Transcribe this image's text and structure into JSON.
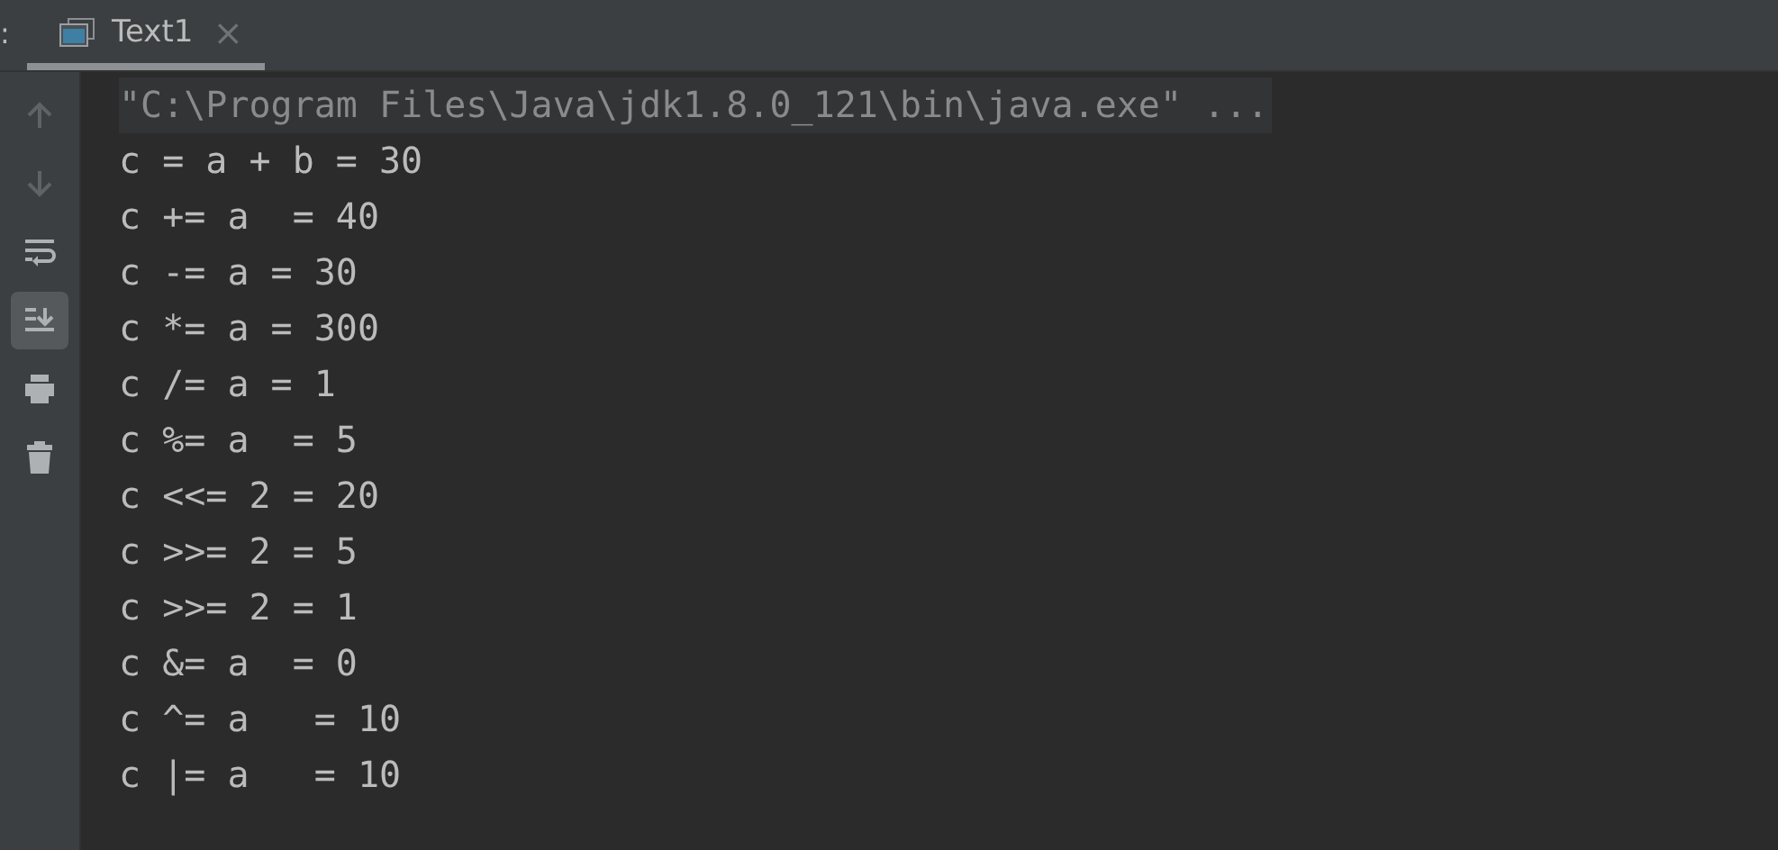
{
  "header": {
    "marker": ":"
  },
  "tabs": [
    {
      "label": "Text1",
      "close": "×",
      "selected": true
    }
  ],
  "toolbar": [
    {
      "kind": "up",
      "disabled": true,
      "selected": false
    },
    {
      "kind": "down",
      "disabled": true,
      "selected": false
    },
    {
      "kind": "wrap",
      "disabled": false,
      "selected": false
    },
    {
      "kind": "scroll-end",
      "disabled": false,
      "selected": true
    },
    {
      "kind": "print",
      "disabled": false,
      "selected": false
    },
    {
      "kind": "trash",
      "disabled": false,
      "selected": false
    }
  ],
  "console": {
    "command": "\"C:\\Program Files\\Java\\jdk1.8.0_121\\bin\\java.exe\" ...",
    "lines": [
      "c = a + b = 30",
      "c += a  = 40",
      "c -= a = 30",
      "c *= a = 300",
      "c /= a = 1",
      "c %= a  = 5",
      "c <<= 2 = 20",
      "c >>= 2 = 5",
      "c >>= 2 = 1",
      "c &= a  = 0",
      "c ^= a   = 10",
      "c |= a   = 10"
    ]
  }
}
